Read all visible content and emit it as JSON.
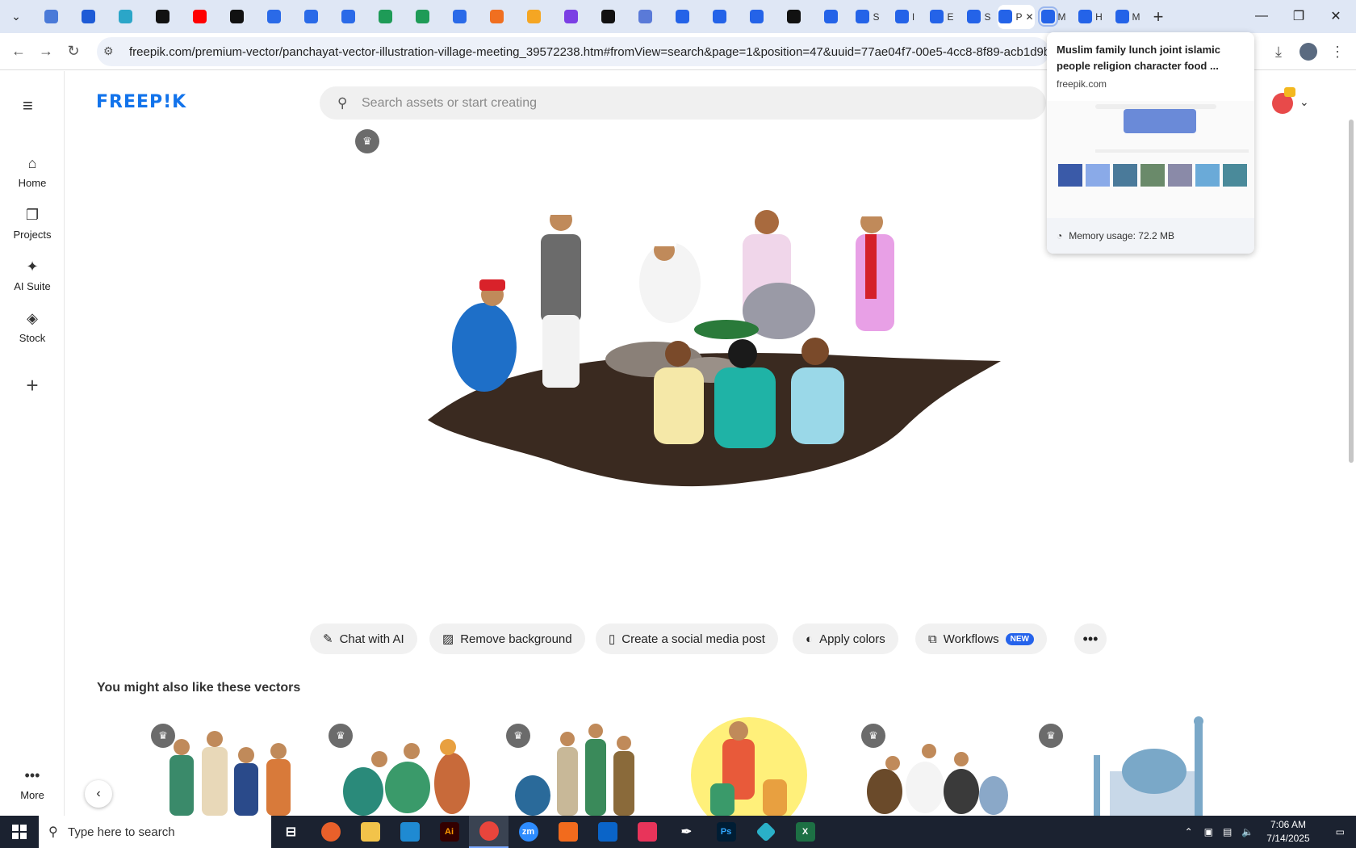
{
  "browser": {
    "tabs": [
      {
        "icon": "tab-list-icon"
      },
      {
        "icon": "generic-site-icon",
        "color": "#4a7ad8"
      },
      {
        "icon": "vpn-icon",
        "color": "#1e5bd6"
      },
      {
        "icon": "hexagon-site-icon",
        "color": "#2ba6c8"
      },
      {
        "icon": "openai-icon",
        "color": "#111111"
      },
      {
        "icon": "youtube-icon",
        "color": "#ff0000"
      },
      {
        "icon": "bolt-icon",
        "color": "#111111"
      },
      {
        "icon": "google-docs-icon",
        "color": "#2a6ae8"
      },
      {
        "icon": "google-docs-icon",
        "color": "#2a6ae8"
      },
      {
        "icon": "google-docs-icon",
        "color": "#2a6ae8"
      },
      {
        "icon": "google-sheets-icon",
        "color": "#1e9b57"
      },
      {
        "icon": "google-sheets-icon",
        "color": "#1e9b57"
      },
      {
        "icon": "site-ma-icon",
        "color": "#2a6ae8"
      },
      {
        "icon": "xampp-icon",
        "color": "#f06f20"
      },
      {
        "icon": "check-site-icon",
        "color": "#f5a623"
      },
      {
        "icon": "code-icon",
        "color": "#7b3fe4"
      },
      {
        "icon": "adobe-a-icon",
        "color": "#111111"
      },
      {
        "icon": "grid-site-icon",
        "color": "#5a7ad8"
      },
      {
        "icon": "freepik-icon",
        "color": "#2463e8"
      },
      {
        "icon": "freepik-icon",
        "color": "#2463e8"
      },
      {
        "icon": "freepik-icon",
        "color": "#2463e8"
      },
      {
        "icon": "medium-icon",
        "color": "#111111"
      },
      {
        "icon": "freepik-icon",
        "color": "#2463e8"
      },
      {
        "icon": "freepik-icon",
        "color": "#2463e8",
        "label": "S"
      },
      {
        "icon": "freepik-icon",
        "color": "#2463e8",
        "label": "I"
      },
      {
        "icon": "freepik-icon",
        "color": "#2463e8",
        "label": "E"
      },
      {
        "icon": "freepik-icon",
        "color": "#2463e8",
        "label": "S"
      },
      {
        "icon": "freepik-icon",
        "color": "#2463e8",
        "label": "P",
        "active": true
      },
      {
        "icon": "freepik-icon",
        "color": "#2463e8",
        "label": "M",
        "hovered": true
      },
      {
        "icon": "freepik-icon",
        "color": "#2463e8",
        "label": "H"
      },
      {
        "icon": "freepik-icon",
        "color": "#2463e8",
        "label": "M"
      }
    ],
    "url": "freepik.com/premium-vector/panchayat-vector-illustration-village-meeting_39572238.htm#fromView=search&page=1&position=47&uuid=77ae04f7-00e5-4cc8-8f89-acb1d9b2382b&q"
  },
  "hover_card": {
    "title": "Muslim family lunch joint islamic people religion character food ...",
    "domain": "freepik.com",
    "memory": "Memory usage: 72.2 MB"
  },
  "site": {
    "logo": "FREEP!K",
    "search_placeholder": "Search assets or start creating",
    "accent": "#1273eb",
    "sidebar": [
      {
        "label": "Home",
        "icon": "home-icon"
      },
      {
        "label": "Projects",
        "icon": "projects-icon"
      },
      {
        "label": "AI Suite",
        "icon": "sparkle-icon"
      },
      {
        "label": "Stock",
        "icon": "stock-icon"
      }
    ],
    "more_label": "More"
  },
  "actions": {
    "chat": "Chat with AI",
    "remove_bg": "Remove background",
    "social": "Create a social media post",
    "colors": "Apply colors",
    "workflows": "Workflows",
    "new_badge": "NEW"
  },
  "related": {
    "heading": "You might also like these vectors"
  },
  "taskbar": {
    "search_placeholder": "Type here to search",
    "time": "7:06 AM",
    "date": "7/14/2025"
  }
}
